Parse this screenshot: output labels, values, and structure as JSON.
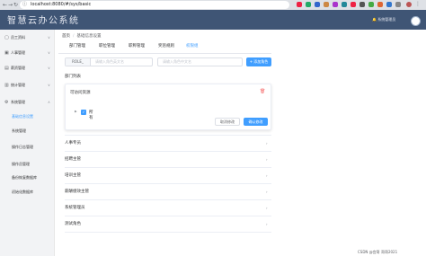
{
  "browser": {
    "url": "localhost:8080/#/sys/basic",
    "nav_back": "←",
    "nav_forward": "→",
    "nav_reload": "↻",
    "nav_home": "⌂",
    "info_icon": "ⓘ"
  },
  "header": {
    "app_title": "智慧云办公系统",
    "user_name": "系统管理员"
  },
  "sidebar": {
    "items": [
      {
        "label": "员工资料",
        "icon": "user-icon",
        "glyph": "▢",
        "arrow": "∨"
      },
      {
        "label": "人事管理",
        "icon": "people-icon",
        "glyph": "▣",
        "arrow": "∨"
      },
      {
        "label": "薪资管理",
        "icon": "money-icon",
        "glyph": "▤",
        "arrow": "∨"
      },
      {
        "label": "统计管理",
        "icon": "chart-icon",
        "glyph": "▥",
        "arrow": "∨"
      },
      {
        "label": "系统管理",
        "icon": "settings-icon",
        "glyph": "⚙",
        "arrow": "∧"
      }
    ],
    "sub_items": [
      {
        "label": "基础信息设置"
      },
      {
        "label": "系统管理"
      },
      {
        "label": "操作日志管理"
      },
      {
        "label": "操作员管理"
      },
      {
        "label": "备份恢复数据库"
      },
      {
        "label": "初始化数据库"
      }
    ]
  },
  "breadcrumb": {
    "home": "首页",
    "separator": "/",
    "current": "基础信息设置"
  },
  "tabs": [
    {
      "label": "部门管理"
    },
    {
      "label": "职位管理"
    },
    {
      "label": "职称管理"
    },
    {
      "label": "奖惩规则"
    },
    {
      "label": "权限组"
    }
  ],
  "role_form": {
    "prefix": "ROLE_",
    "role_placeholder": "请输入角色英文名",
    "name_placeholder": "请输入角色中文名",
    "add_button": "+ 添加角色"
  },
  "dept_section": {
    "label": "部门列表",
    "card_title": "可访问资源",
    "tree_caret": "▶",
    "tree_check": "✓",
    "tree_label": "所有",
    "trash_glyph": "🗑",
    "cancel_button": "取消修改",
    "confirm_button": "确认修改"
  },
  "accordion": [
    {
      "label": "人事专员",
      "arrow": "›"
    },
    {
      "label": "招聘主管",
      "arrow": "›"
    },
    {
      "label": "培训主管",
      "arrow": "›"
    },
    {
      "label": "薪酬绩效主管",
      "arrow": "›"
    },
    {
      "label": "系统管理员",
      "arrow": "›"
    },
    {
      "label": "测试角色",
      "arrow": "›"
    }
  ],
  "watermark": "CSDN @宫哥 哥哥2021",
  "colors": {
    "header_bg": "#3f5575",
    "accent": "#409eff",
    "danger": "#f56c6c"
  }
}
